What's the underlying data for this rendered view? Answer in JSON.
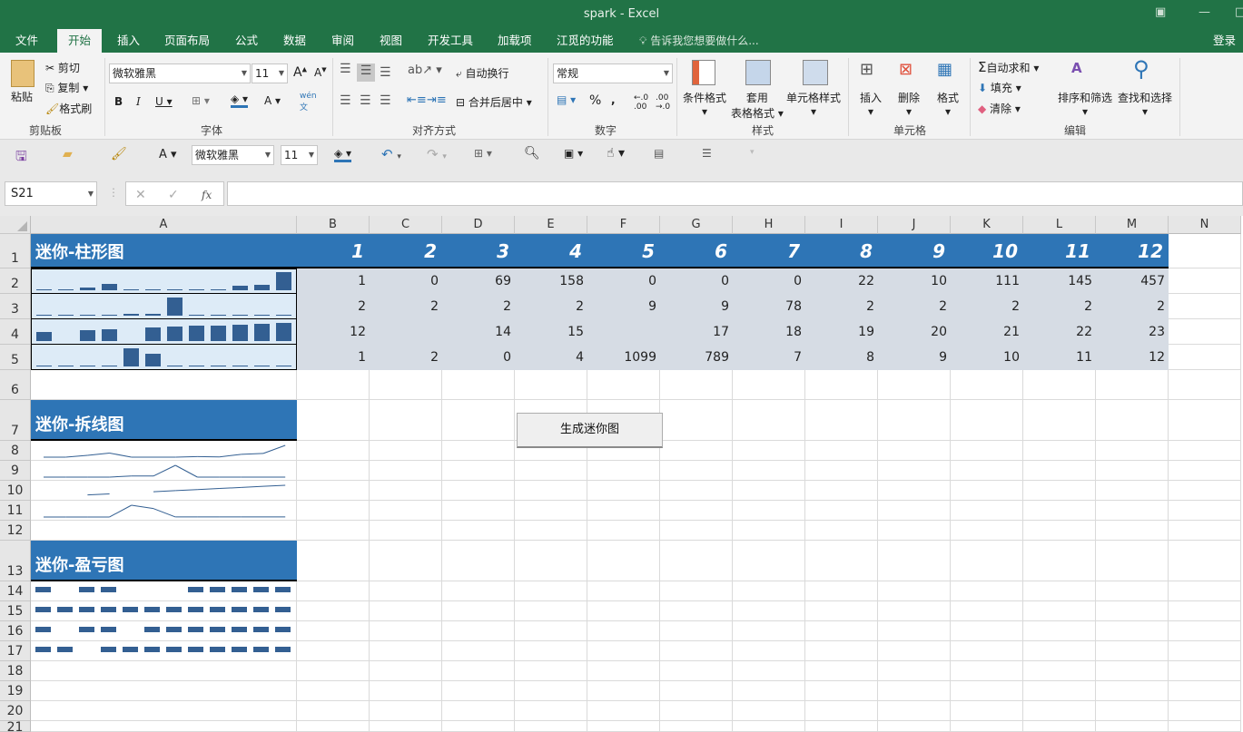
{
  "window": {
    "title": "spark - Excel"
  },
  "tabs": [
    {
      "label": "文件"
    },
    {
      "label": "开始"
    },
    {
      "label": "插入"
    },
    {
      "label": "页面布局"
    },
    {
      "label": "公式"
    },
    {
      "label": "数据"
    },
    {
      "label": "审阅"
    },
    {
      "label": "视图"
    },
    {
      "label": "开发工具"
    },
    {
      "label": "加载项"
    },
    {
      "label": "江觅的功能"
    }
  ],
  "tell_me": "告诉我您想要做什么...",
  "login": "登录",
  "ribbon": {
    "clipboard": {
      "paste": "粘贴",
      "cut": "剪切",
      "copy": "复制",
      "format_painter": "格式刷",
      "label": "剪贴板"
    },
    "font": {
      "name": "微软雅黑",
      "size": "11",
      "label": "字体"
    },
    "alignment": {
      "wrap": "自动换行",
      "merge": "合并后居中",
      "label": "对齐方式"
    },
    "number": {
      "format": "常规",
      "label": "数字"
    },
    "styles": {
      "conditional": "条件格式",
      "table_l1": "套用",
      "table_l2": "表格格式",
      "cell_styles": "单元格样式",
      "label": "样式"
    },
    "cells": {
      "insert": "插入",
      "delete": "删除",
      "format": "格式",
      "label": "单元格"
    },
    "editing": {
      "autosum": "自动求和",
      "fill": "填充",
      "clear": "清除",
      "sort": "排序和筛选",
      "find": "查找和选择",
      "label": "编辑"
    }
  },
  "qat": {
    "font": "微软雅黑",
    "size": "11"
  },
  "formula_bar": {
    "name_box": "S21",
    "formula": ""
  },
  "columns": [
    "A",
    "B",
    "C",
    "D",
    "E",
    "F",
    "G",
    "H",
    "I",
    "J",
    "K",
    "L",
    "M",
    "N"
  ],
  "rows": [
    "1",
    "2",
    "3",
    "4",
    "5",
    "6",
    "7",
    "8",
    "9",
    "10",
    "11",
    "12",
    "13",
    "14",
    "15",
    "16",
    "17",
    "18",
    "19",
    "20",
    "21"
  ],
  "sections": {
    "column": "迷你-柱形图",
    "line": "迷你-拆线图",
    "winloss": "迷你-盈亏图"
  },
  "header_numbers": [
    "1",
    "2",
    "3",
    "4",
    "5",
    "6",
    "7",
    "8",
    "9",
    "10",
    "11",
    "12"
  ],
  "table": [
    [
      1,
      0,
      69,
      158,
      0,
      0,
      0,
      22,
      10,
      111,
      145,
      457
    ],
    [
      2,
      2,
      2,
      2,
      9,
      9,
      78,
      2,
      2,
      2,
      2,
      2
    ],
    [
      12,
      null,
      14,
      15,
      null,
      17,
      18,
      19,
      20,
      21,
      22,
      23
    ],
    [
      1,
      2,
      0,
      4,
      1099,
      789,
      7,
      8,
      9,
      10,
      11,
      12
    ]
  ],
  "button": {
    "label": "生成迷你图"
  },
  "colors": {
    "excel_green": "#217346",
    "header_blue": "#2e75b6",
    "spark": "#335f92",
    "data_bg": "#d6dce4",
    "spark_bg": "#ddebf7"
  }
}
